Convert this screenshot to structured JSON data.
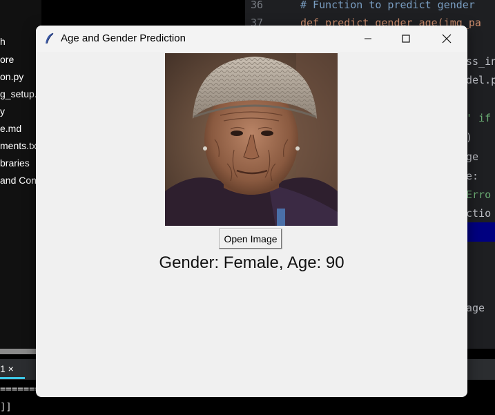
{
  "window": {
    "title": "Age and Gender Prediction",
    "controls": {
      "minimize_icon": "minimize-icon",
      "maximize_icon": "maximize-icon",
      "close_icon": "close-icon"
    }
  },
  "main": {
    "image_alt": "Photo of an elderly woman",
    "open_button_label": "Open Image",
    "result_text": "Gender: Female, Age: 90"
  },
  "background": {
    "explorer_items": [
      "h",
      "ore",
      "on.py",
      "g_setup.p",
      "y",
      "e.md",
      "ments.tx",
      "braries",
      "and Con"
    ],
    "editor_lines": [
      {
        "num": "36",
        "code": "# Function to predict gender"
      },
      {
        "num": "37",
        "code": "def predict_gender_age(img_pa"
      }
    ],
    "editor_fragments": [
      "ss_in",
      "del.p",
      "' if",
      ")",
      "ge",
      "e:",
      "Erro",
      "ctio",
      "age "
    ],
    "bottom_tab_label": "1 ×",
    "console_line1": "=======",
    "console_line2": "]]"
  }
}
